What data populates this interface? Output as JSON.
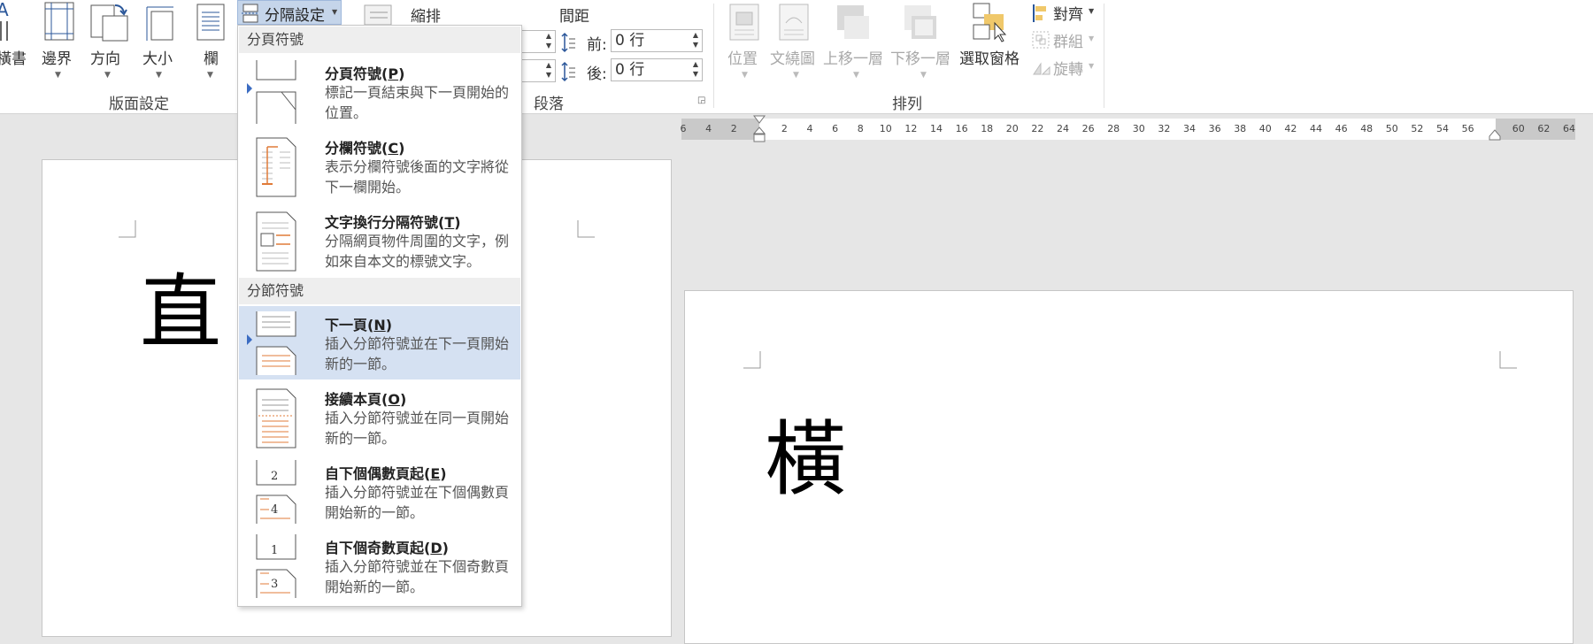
{
  "ribbon": {
    "page_setup": {
      "group_title": "版面設定",
      "text_direction_label": "橫書",
      "margins_label": "邊界",
      "orientation_label": "方向",
      "size_label": "大小",
      "columns_label": "欄",
      "breaks_label": "分隔設定"
    },
    "paragraph": {
      "group_title": "段落",
      "indent_header": "縮排",
      "spacing_header": "間距",
      "before_label": "前:",
      "after_label": "後:",
      "before_value": "0 行",
      "after_value": "0 行"
    },
    "arrange": {
      "group_title": "排列",
      "position_label": "位置",
      "wrap_text_label": "文繞圖",
      "bring_forward_label": "上移一層",
      "send_backward_label": "下移一層",
      "selection_pane_label": "選取窗格",
      "align_label": "對齊",
      "group_label": "群組",
      "rotate_label": "旋轉"
    }
  },
  "ruler": {
    "ticks": [
      "6",
      "4",
      "2",
      "2",
      "4",
      "6",
      "8",
      "10",
      "12",
      "14",
      "16",
      "18",
      "20",
      "22",
      "24",
      "26",
      "28",
      "30",
      "32",
      "34",
      "36",
      "38",
      "40",
      "42",
      "44",
      "46",
      "48",
      "50",
      "52",
      "54",
      "56",
      "60",
      "62",
      "64"
    ]
  },
  "document": {
    "page1_char": "直",
    "page2_char": "橫"
  },
  "breaks_menu": {
    "page_breaks_header": "分頁符號",
    "section_breaks_header": "分節符號",
    "items": [
      {
        "title": "分頁符號(",
        "key": "P",
        "title_end": ")",
        "desc": "標記一頁結束與下一頁開始的位置。"
      },
      {
        "title": "分欄符號(",
        "key": "C",
        "title_end": ")",
        "desc": "表示分欄符號後面的文字將從下一欄開始。"
      },
      {
        "title": "文字換行分隔符號(",
        "key": "T",
        "title_end": ")",
        "desc": "分隔網頁物件周圍的文字，例如來自本文的標號文字。"
      },
      {
        "title": "下一頁(",
        "key": "N",
        "title_end": ")",
        "desc": "插入分節符號並在下一頁開始新的一節。"
      },
      {
        "title": "接續本頁(",
        "key": "O",
        "title_end": ")",
        "desc": "插入分節符號並在同一頁開始新的一節。"
      },
      {
        "title": "自下個偶數頁起(",
        "key": "E",
        "title_end": ")",
        "desc": "插入分節符號並在下個偶數頁開始新的一節。",
        "icon_nums": [
          "2",
          "4"
        ]
      },
      {
        "title": "自下個奇數頁起(",
        "key": "D",
        "title_end": ")",
        "desc": "插入分節符號並在下個奇數頁開始新的一節。",
        "icon_nums": [
          "1",
          "3"
        ]
      }
    ]
  },
  "colors": {
    "accent_blue": "#2b579a",
    "highlight": "#d5e1f2",
    "orange_line": "#e07b39"
  }
}
